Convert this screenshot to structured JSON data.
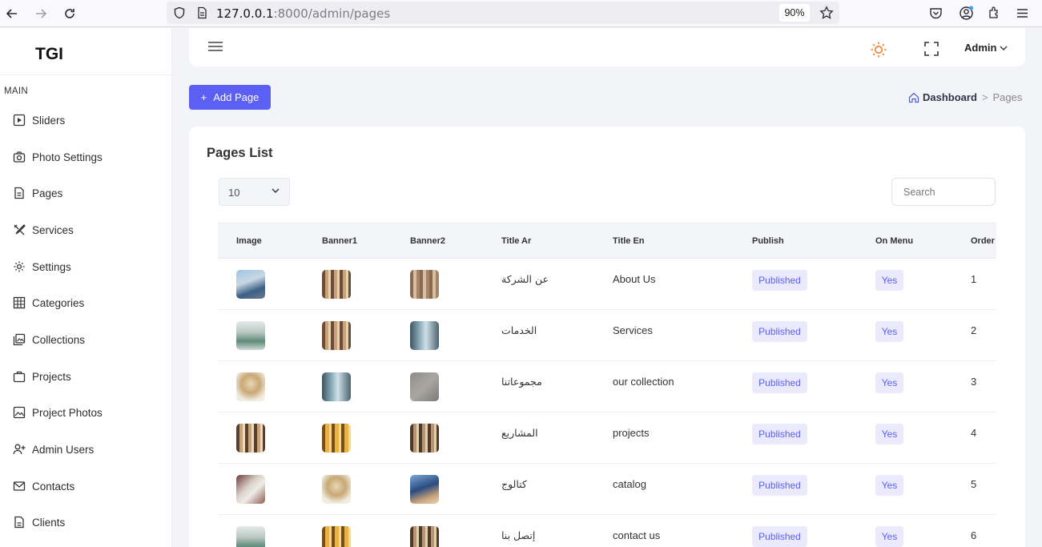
{
  "browser": {
    "url_host": "127.0.0.1",
    "url_rest": ":8000/admin/pages",
    "zoom": "90%"
  },
  "sidebar": {
    "logo": "TGI",
    "section": "MAIN",
    "items": [
      {
        "label": "Sliders",
        "icon": "play-square-icon"
      },
      {
        "label": "Photo Settings",
        "icon": "camera-icon"
      },
      {
        "label": "Pages",
        "icon": "file-icon"
      },
      {
        "label": "Services",
        "icon": "tools-icon"
      },
      {
        "label": "Settings",
        "icon": "gear-icon"
      },
      {
        "label": "Categories",
        "icon": "grid-icon"
      },
      {
        "label": "Collections",
        "icon": "images-icon"
      },
      {
        "label": "Projects",
        "icon": "briefcase-icon"
      },
      {
        "label": "Project Photos",
        "icon": "image-icon"
      },
      {
        "label": "Admin Users",
        "icon": "user-plus-icon"
      },
      {
        "label": "Contacts",
        "icon": "mail-icon"
      },
      {
        "label": "Clients",
        "icon": "document-icon"
      }
    ]
  },
  "header": {
    "admin_label": "Admin"
  },
  "toolbar": {
    "add_label": "Add Page",
    "add_plus": "+"
  },
  "breadcrumb": {
    "home": "Dashboard",
    "separator": ">",
    "current": "Pages"
  },
  "card": {
    "title": "Pages List",
    "page_size": "10",
    "search_placeholder": "Search"
  },
  "table": {
    "columns": [
      "Image",
      "Banner1",
      "Banner2",
      "Title Ar",
      "Title En",
      "Publish",
      "On Menu",
      "Order"
    ],
    "rows": [
      {
        "title_ar": "عن الشركة",
        "title_en": "About Us",
        "publish": "Published",
        "on_menu": "Yes",
        "order": "1"
      },
      {
        "title_ar": "الخدمات",
        "title_en": "Services",
        "publish": "Published",
        "on_menu": "Yes",
        "order": "2"
      },
      {
        "title_ar": "مجموعاتنا",
        "title_en": "our collection",
        "publish": "Published",
        "on_menu": "Yes",
        "order": "3"
      },
      {
        "title_ar": "المشاريع",
        "title_en": "projects",
        "publish": "Published",
        "on_menu": "Yes",
        "order": "4"
      },
      {
        "title_ar": "كتالوج",
        "title_en": "catalog",
        "publish": "Published",
        "on_menu": "Yes",
        "order": "5"
      },
      {
        "title_ar": "إتصل بنا",
        "title_en": "contact us",
        "publish": "Published",
        "on_menu": "Yes",
        "order": "6"
      }
    ]
  },
  "colors": {
    "accent": "#5b5ff4",
    "badge_bg": "#ebeafd",
    "sun": "#f07b2b"
  }
}
